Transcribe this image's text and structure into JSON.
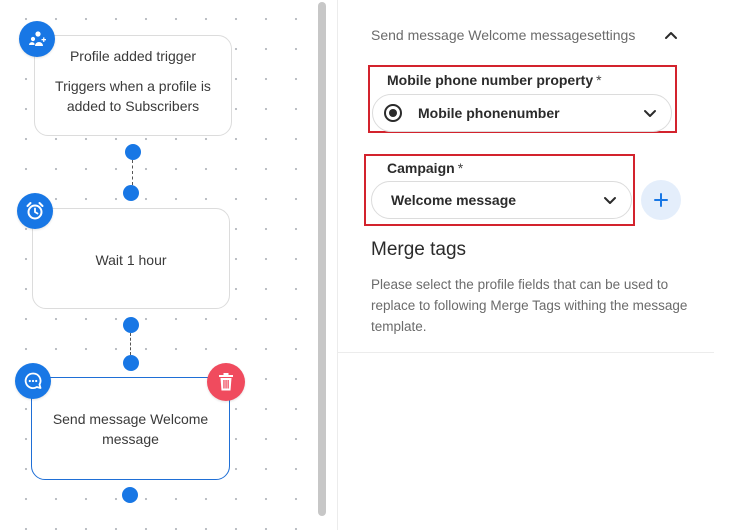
{
  "workflow": {
    "trigger_node": {
      "title": "Profile added trigger",
      "description": "Triggers when a profile is added to Subscribers",
      "icon": "profile-add-icon"
    },
    "wait_node": {
      "title": "Wait 1 hour",
      "icon": "alarm-clock-icon"
    },
    "message_node": {
      "title": "Send message Welcome message",
      "icon": "chat-bubble-icon",
      "delete_icon": "trash-icon",
      "selected": true
    }
  },
  "settings": {
    "title": "Send message Welcome messagesettings",
    "collapse_icon": "chevron-up-icon",
    "phone_property": {
      "label": "Mobile phone number property",
      "required_mark": "*",
      "value": "Mobile phonenumber"
    },
    "campaign": {
      "label": "Campaign",
      "required_mark": "*",
      "value": "Welcome message",
      "add_icon": "plus-icon"
    },
    "merge_tags": {
      "heading": "Merge tags",
      "description": "Please select the profile fields that can be used to replace to following Merge Tags withing the message template."
    }
  },
  "colors": {
    "accent": "#1877e5",
    "danger": "#f04b5e",
    "highlight": "#d3232d",
    "selected_border": "#1f6fd6"
  }
}
